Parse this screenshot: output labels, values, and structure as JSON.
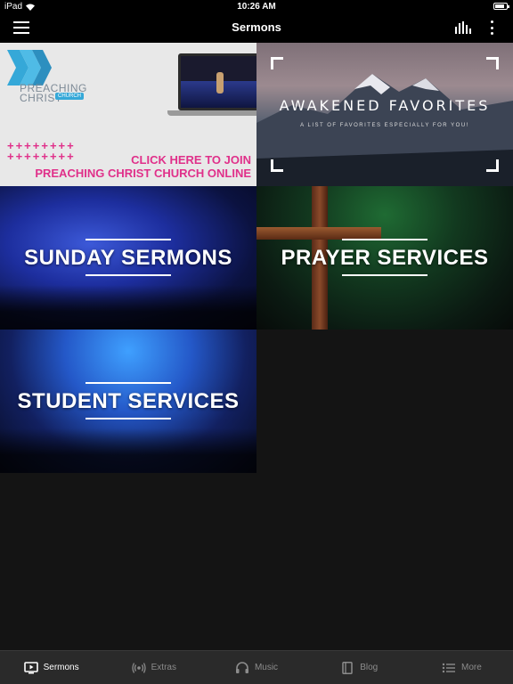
{
  "status_bar": {
    "device": "iPad",
    "time": "10:26 AM",
    "battery_level": 0.85
  },
  "header": {
    "title": "Sermons"
  },
  "tiles": {
    "preaching_christ": {
      "logo_line1": "PREACHING",
      "logo_line2": "CHRIST",
      "logo_badge": "CHURCH",
      "plus_row1": "++++++++",
      "plus_row2": "++++++++",
      "cta_line1": "CLICK HERE TO JOIN",
      "cta_line2": "PREACHING CHRIST CHURCH ONLINE"
    },
    "awakened_favorites": {
      "title": "AWAKENED FAVORITES",
      "subtitle": "A LIST OF FAVORITES ESPECIALLY FOR YOU!"
    },
    "sunday_sermons": {
      "label": "SUNDAY SERMONS"
    },
    "prayer_services": {
      "label": "PRAYER SERVICES"
    },
    "student_services": {
      "label": "STUDENT SERVICES"
    }
  },
  "tab_bar": {
    "active": "Sermons",
    "items": [
      {
        "label": "Sermons",
        "icon": "tv-play-icon"
      },
      {
        "label": "Extras",
        "icon": "broadcast-icon"
      },
      {
        "label": "Music",
        "icon": "headphones-icon"
      },
      {
        "label": "Blog",
        "icon": "book-icon"
      },
      {
        "label": "More",
        "icon": "list-icon"
      }
    ]
  },
  "colors": {
    "accent_pink": "#e0308a",
    "logo_blue": "#35a8d8",
    "background": "#141414",
    "tab_bar": "#2a2a2a"
  }
}
